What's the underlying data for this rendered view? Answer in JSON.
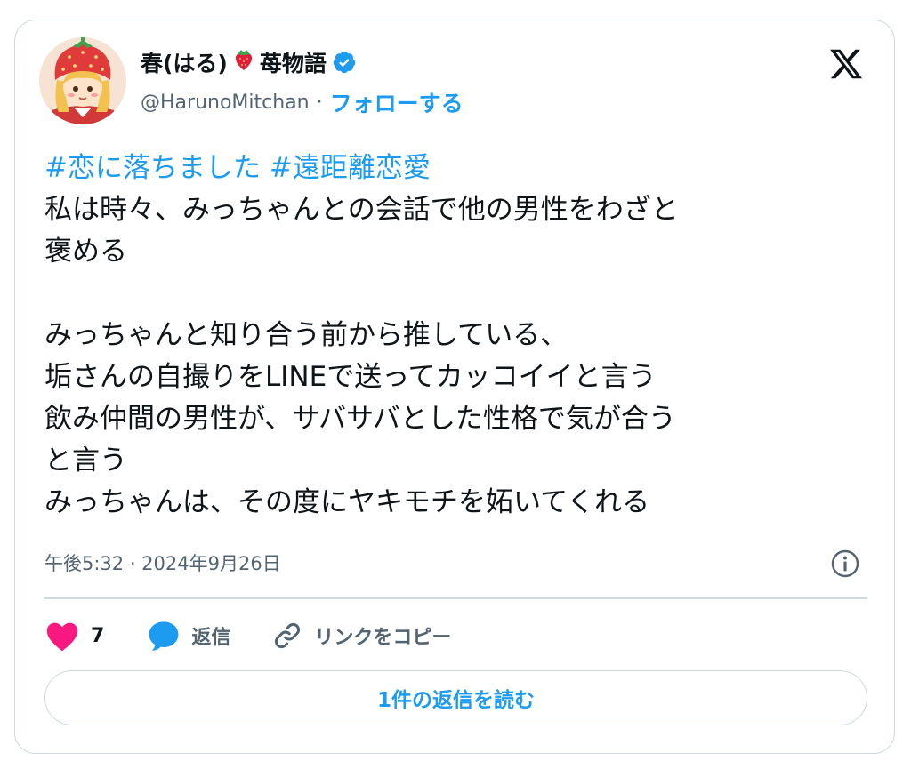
{
  "author": {
    "display_name": "春(はる)",
    "emoji": "🍓",
    "name_suffix": "苺物語",
    "handle": "@HarunoMitchan",
    "separator": "·",
    "follow_label": "フォローする",
    "verified": true
  },
  "brand": {
    "logo_icon": "x-logo-icon"
  },
  "tweet": {
    "hashtags": [
      "#恋に落ちました",
      "#遠距離恋愛"
    ],
    "body": "私は時々、みっちゃんとの会話で他の男性をわざと\n褒める\n\nみっちゃんと知り合う前から推している、\n垢さんの自撮りをLINEで送ってカッコイイと言う\n飲み仲間の男性が、サバサバとした性格で気が合う\nと言う\nみっちゃんは、その度にヤキモチを妬いてくれる",
    "timestamp": "午後5:32 · 2024年9月26日"
  },
  "actions": {
    "like_count": "7",
    "reply_label": "返信",
    "copy_link_label": "リンクをコピー"
  },
  "read_replies_label": "1件の返信を読む",
  "colors": {
    "accent": "#1d9bf0",
    "like": "#f91880",
    "text": "#0f1419",
    "secondary": "#536471",
    "border": "#cfd9de",
    "verified": "#1d9bf0"
  }
}
